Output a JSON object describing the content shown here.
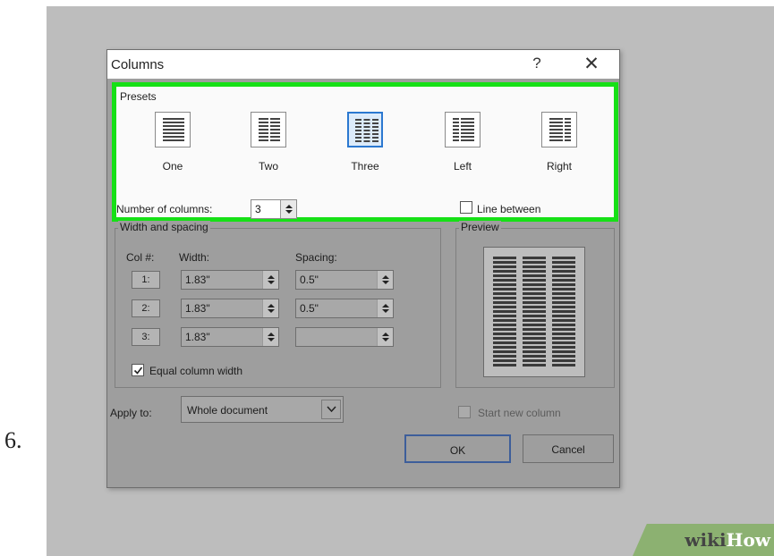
{
  "step_number": "6.",
  "watermark": {
    "part1": "wiki",
    "part2": "How"
  },
  "dialog": {
    "title": "Columns",
    "help_label": "?",
    "close_label": "✕",
    "presets": {
      "group_label": "Presets",
      "options": [
        {
          "label": "One",
          "icon": "one-column-icon",
          "selected": false
        },
        {
          "label": "Two",
          "icon": "two-columns-icon",
          "selected": false
        },
        {
          "label": "Three",
          "icon": "three-columns-icon",
          "selected": true
        },
        {
          "label": "Left",
          "icon": "left-columns-icon",
          "selected": false
        },
        {
          "label": "Right",
          "icon": "right-columns-icon",
          "selected": false
        }
      ]
    },
    "number_of_columns": {
      "label": "Number of columns:",
      "value": "3"
    },
    "line_between": {
      "label": "Line between",
      "checked": false
    },
    "width_spacing": {
      "group_label": "Width and spacing",
      "headers": {
        "col": "Col #:",
        "width": "Width:",
        "spacing": "Spacing:"
      },
      "rows": [
        {
          "col": "1:",
          "width": "1.83\"",
          "spacing": "0.5\""
        },
        {
          "col": "2:",
          "width": "1.83\"",
          "spacing": "0.5\""
        },
        {
          "col": "3:",
          "width": "1.83\"",
          "spacing": ""
        }
      ],
      "equal_width": {
        "label": "Equal column width",
        "checked": true
      }
    },
    "preview": {
      "group_label": "Preview",
      "columns": 3
    },
    "apply_to": {
      "label": "Apply to:",
      "value": "Whole document"
    },
    "start_new_column": {
      "label": "Start new column",
      "checked": false,
      "enabled": false
    },
    "ok_label": "OK",
    "cancel_label": "Cancel"
  },
  "colors": {
    "highlight": "#16e016",
    "selected": "#2b78d0",
    "overlay": "#9e9e9e",
    "watermark": "#8cb171"
  }
}
